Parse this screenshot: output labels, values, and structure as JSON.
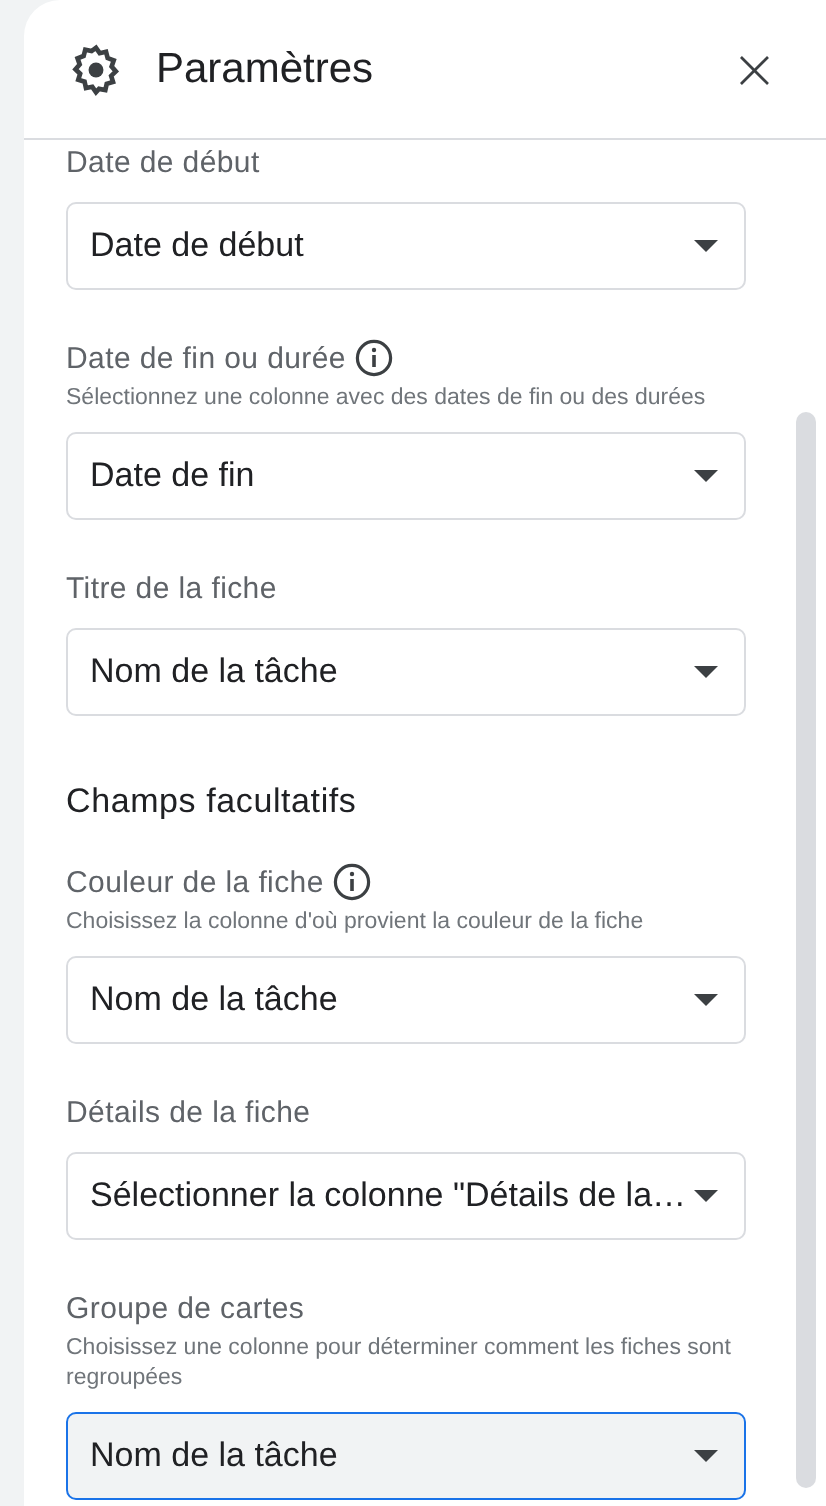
{
  "header": {
    "title": "Paramètres",
    "close": "×"
  },
  "items": [
    {
      "kind": "field",
      "label": "Date de début",
      "info": false,
      "value": "Date de début",
      "focused": false
    },
    {
      "kind": "field",
      "label": "Date de fin ou durée",
      "info": true,
      "hint": "Sélectionnez une colonne avec des dates de fin ou des durées",
      "value": "Date de fin",
      "focused": false
    },
    {
      "kind": "field",
      "label": "Titre de la fiche",
      "info": false,
      "value": "Nom de la tâche",
      "focused": false
    },
    {
      "kind": "heading",
      "label": "Champs facultatifs"
    },
    {
      "kind": "field",
      "label": "Couleur de la fiche",
      "info": true,
      "hint": "Choisissez la colonne d'où provient la couleur de la fiche",
      "value": "Nom de la tâche",
      "focused": false
    },
    {
      "kind": "field",
      "label": "Détails de la fiche",
      "info": false,
      "value": "Sélectionner la colonne \"Détails de la…",
      "focused": false
    },
    {
      "kind": "field",
      "label": "Groupe de cartes",
      "info": false,
      "hint": "Choisissez une colonne pour déterminer comment les fiches sont regroupées",
      "value": "Nom de la tâche",
      "focused": true
    }
  ]
}
